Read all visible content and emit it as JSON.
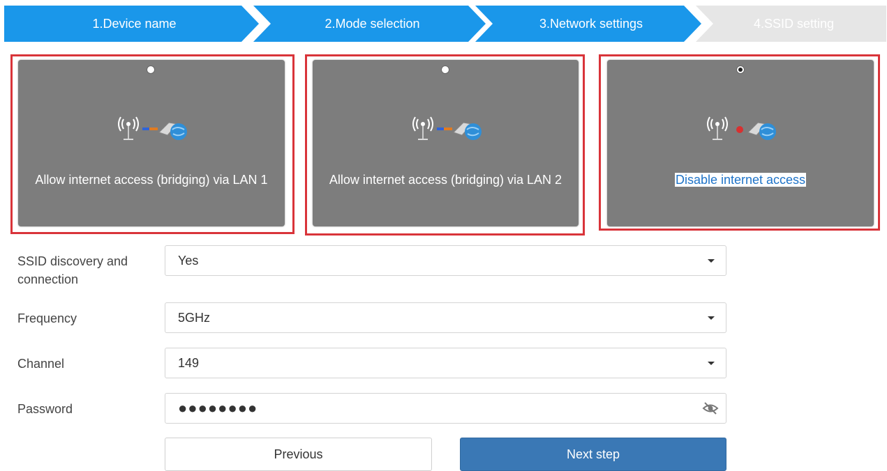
{
  "steps": [
    {
      "label": "1.Device name",
      "state": "done"
    },
    {
      "label": "2.Mode selection",
      "state": "done"
    },
    {
      "label": "3.Network settings",
      "state": "active"
    },
    {
      "label": "4.SSID setting",
      "state": "pending"
    }
  ],
  "cards": [
    {
      "label": "Allow internet access (bridging) via LAN 1",
      "selected": false,
      "icon": "bridge-lan-icon"
    },
    {
      "label": "Allow internet access (bridging) via LAN 2",
      "selected": false,
      "icon": "bridge-lan-icon"
    },
    {
      "label": "Disable internet access",
      "selected": true,
      "icon": "disabled-network-icon"
    }
  ],
  "form": {
    "ssid_discovery": {
      "label": "SSID discovery and connection",
      "value": "Yes"
    },
    "frequency": {
      "label": "Frequency",
      "value": "5GHz"
    },
    "channel": {
      "label": "Channel",
      "value": "149"
    },
    "password": {
      "label": "Password",
      "value": "●●●●●●●●"
    }
  },
  "buttons": {
    "previous": "Previous",
    "next": "Next step"
  },
  "colors": {
    "accent": "#1a97ea",
    "highlight_border": "#d9343a",
    "card_bg": "#7d7d7d",
    "primary_button": "#3a78b5"
  }
}
